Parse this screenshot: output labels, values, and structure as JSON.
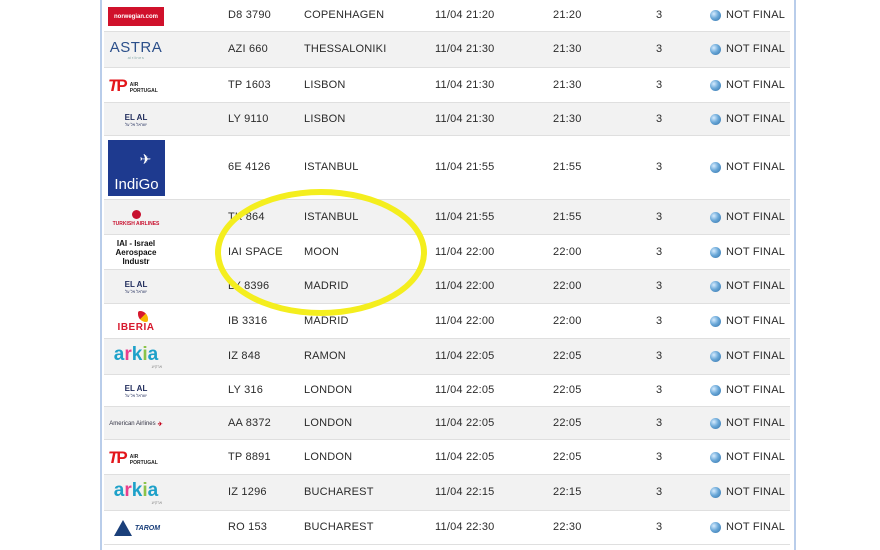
{
  "flights": [
    {
      "airline": "norwegian.com",
      "logo": "norwegian",
      "flight": "D8 3790",
      "destination": "COPENHAGEN",
      "scheduled": "11/04 21:20",
      "estimated": "21:20",
      "terminal": "3",
      "status": "NOT FINAL"
    },
    {
      "airline": "ASTRA",
      "logo": "astra",
      "flight": "AZI 660",
      "destination": "THESSALONIKI",
      "scheduled": "11/04 21:30",
      "estimated": "21:30",
      "terminal": "3",
      "status": "NOT FINAL"
    },
    {
      "airline": "TAP AIR PORTUGAL",
      "logo": "tap",
      "flight": "TP 1603",
      "destination": "LISBON",
      "scheduled": "11/04 21:30",
      "estimated": "21:30",
      "terminal": "3",
      "status": "NOT FINAL"
    },
    {
      "airline": "EL AL",
      "logo": "elal",
      "flight": "LY 9110",
      "destination": "LISBON",
      "scheduled": "11/04 21:30",
      "estimated": "21:30",
      "terminal": "3",
      "status": "NOT FINAL"
    },
    {
      "airline": "IndiGo",
      "logo": "indigo",
      "flight": "6E 4126",
      "destination": "ISTANBUL",
      "scheduled": "11/04 21:55",
      "estimated": "21:55",
      "terminal": "3",
      "status": "NOT FINAL"
    },
    {
      "airline": "TURKISH AIRLINES",
      "logo": "turkish",
      "flight": "TK 864",
      "destination": "ISTANBUL",
      "scheduled": "11/04 21:55",
      "estimated": "21:55",
      "terminal": "3",
      "status": "NOT FINAL"
    },
    {
      "airline": "IAI - Israel Aerospace Industr",
      "logo": "text",
      "flight": "IAI SPACE",
      "destination": "MOON",
      "scheduled": "11/04 22:00",
      "estimated": "22:00",
      "terminal": "3",
      "status": "NOT FINAL"
    },
    {
      "airline": "EL AL",
      "logo": "elal",
      "flight": "LY 8396",
      "destination": "MADRID",
      "scheduled": "11/04 22:00",
      "estimated": "22:00",
      "terminal": "3",
      "status": "NOT FINAL"
    },
    {
      "airline": "IBERIA",
      "logo": "iberia",
      "flight": "IB 3316",
      "destination": "MADRID",
      "scheduled": "11/04 22:00",
      "estimated": "22:00",
      "terminal": "3",
      "status": "NOT FINAL"
    },
    {
      "airline": "arkia",
      "logo": "arkia",
      "flight": "IZ 848",
      "destination": "RAMON",
      "scheduled": "11/04 22:05",
      "estimated": "22:05",
      "terminal": "3",
      "status": "NOT FINAL"
    },
    {
      "airline": "EL AL",
      "logo": "elal",
      "flight": "LY 316",
      "destination": "LONDON",
      "scheduled": "11/04 22:05",
      "estimated": "22:05",
      "terminal": "3",
      "status": "NOT FINAL"
    },
    {
      "airline": "American Airlines",
      "logo": "aa",
      "flight": "AA 8372",
      "destination": "LONDON",
      "scheduled": "11/04 22:05",
      "estimated": "22:05",
      "terminal": "3",
      "status": "NOT FINAL"
    },
    {
      "airline": "TAP AIR PORTUGAL",
      "logo": "tap",
      "flight": "TP 8891",
      "destination": "LONDON",
      "scheduled": "11/04 22:05",
      "estimated": "22:05",
      "terminal": "3",
      "status": "NOT FINAL"
    },
    {
      "airline": "arkia",
      "logo": "arkia",
      "flight": "IZ 1296",
      "destination": "BUCHAREST",
      "scheduled": "11/04 22:15",
      "estimated": "22:15",
      "terminal": "3",
      "status": "NOT FINAL"
    },
    {
      "airline": "TAROM",
      "logo": "tarom",
      "flight": "RO 153",
      "destination": "BUCHAREST",
      "scheduled": "11/04 22:30",
      "estimated": "22:30",
      "terminal": "3",
      "status": "NOT FINAL"
    }
  ],
  "logo_text": {
    "norwegian": "norwegian.com",
    "astra": "ASTRA",
    "astra_sub": "airlines",
    "tap_t": "T",
    "tap_p": "P",
    "tap_sub": "AIR PORTUGAL",
    "elal": "EL AL",
    "elal_sub": "ישראל אל על",
    "indigo": "IndiGo",
    "turkish": "TURKISH AIRLINES",
    "iai": "IAI - Israel Aerospace Industr",
    "iberia": "IBERIA",
    "arkia_sub": "ארקיע",
    "aa": "American Airlines",
    "tarom": "TAROM"
  },
  "colors": {
    "row_alt": "#f2f2f2",
    "frame_border": "#b9cdea",
    "highlight": "#f4ee1e"
  }
}
